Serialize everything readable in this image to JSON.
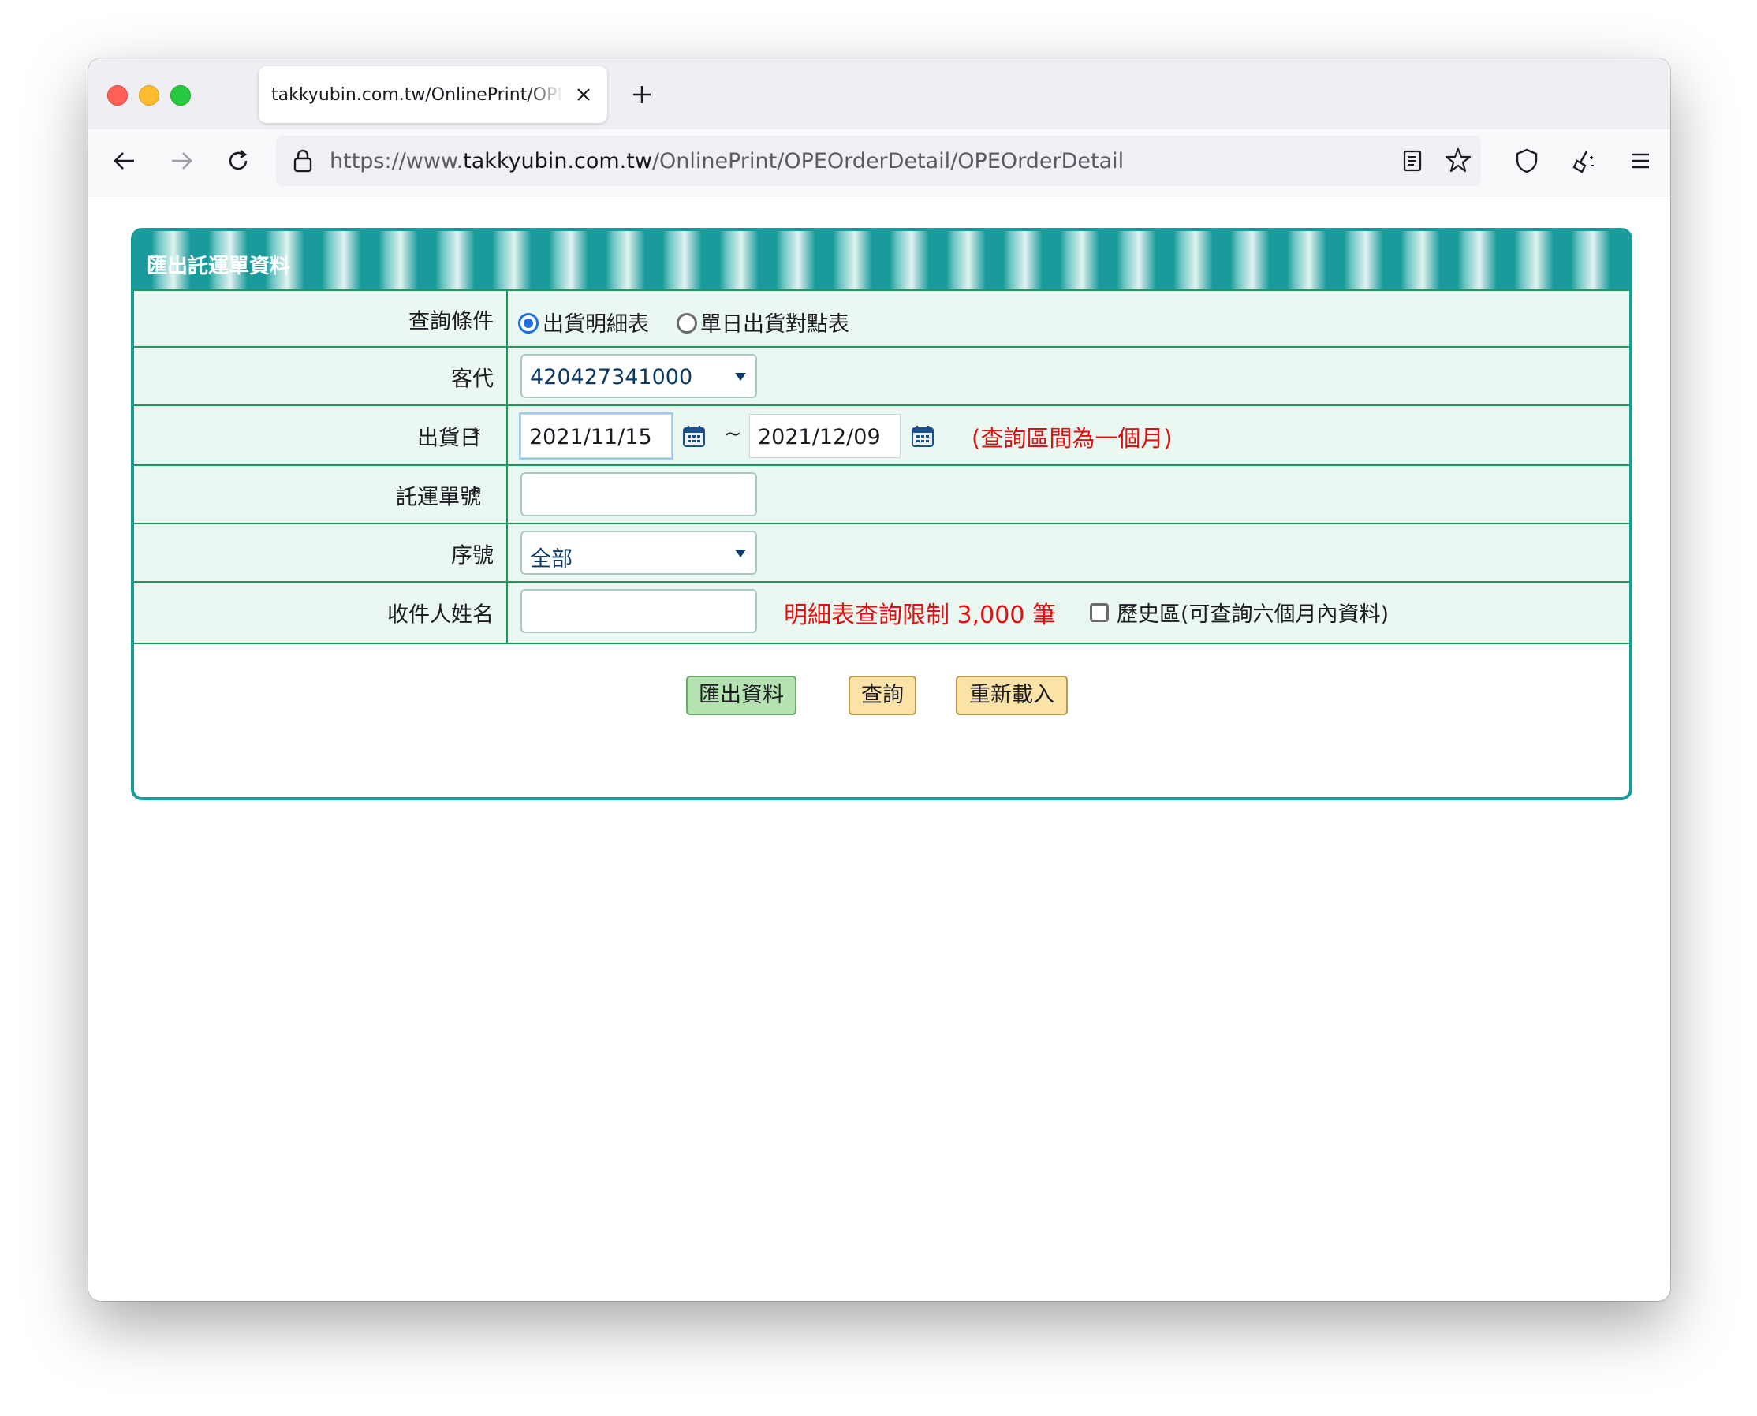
{
  "browser": {
    "tab_title": "takkyubin.com.tw/OnlinePrint/OPEOrderDetail",
    "url_prefix": "https://www.",
    "url_host": "takkyubin.com.tw",
    "url_path": "/OnlinePrint/OPEOrderDetail/OPEOrderDetail"
  },
  "panel": {
    "title": "匯出託運單資料"
  },
  "form": {
    "query_condition": {
      "label": "查詢條件",
      "options": [
        "出貨明細表",
        "單日出貨對點表"
      ],
      "selected_index": 0
    },
    "customer_code": {
      "label": "客代",
      "value": "420427341000"
    },
    "ship_date": {
      "required_mark": "*",
      "label": "出貨日",
      "from": "2021/11/15",
      "separator": "~",
      "to": "2021/12/09",
      "note": "(查詢區間為一個月)"
    },
    "waybill_no": {
      "required_mark": "*",
      "label": "託運單號",
      "value": ""
    },
    "serial": {
      "label": "序號",
      "value": "全部"
    },
    "recipient_name": {
      "label": "收件人姓名",
      "value": "",
      "limit_note": "明細表查詢限制 3,000 筆",
      "history_label": "歷史區(可查詢六個月內資料)",
      "history_checked": false
    }
  },
  "buttons": {
    "export": "匯出資料",
    "query": "查詢",
    "reload": "重新載入"
  },
  "colors": {
    "accent": "#1a9a9a",
    "row_bg": "#ebf8f2",
    "warning": "#e01010"
  }
}
